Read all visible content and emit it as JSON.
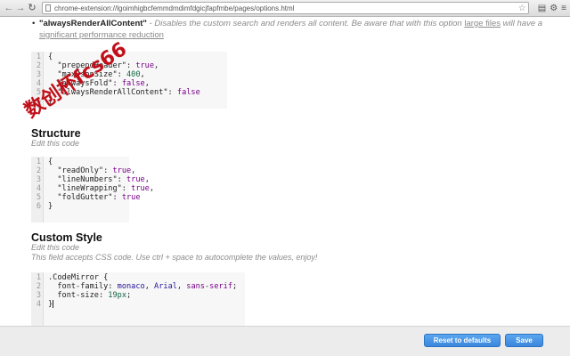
{
  "browser": {
    "url": "chrome-extension://lgoimhigbcfemmdmdimfdgicjfapfmbe/pages/options.html"
  },
  "options": {
    "bullet_title": "\"alwaysRenderAllContent\"",
    "bullet_desc_1": " - Disables the custom search and renders all content. Be aware that with this option ",
    "bullet_link_1": "large files",
    "bullet_desc_2": " will have a ",
    "bullet_link_2": "significant performance reduction"
  },
  "json_code": {
    "lines": [
      {
        "n": "1",
        "t": "{"
      },
      {
        "n": "2",
        "key": "\"prependHeader\"",
        "val": "true",
        "cls": "v"
      },
      {
        "n": "3",
        "key": "\"maxJsonSize\"",
        "val": "400",
        "cls": "n"
      },
      {
        "n": "4",
        "key": "\"alwaysFold\"",
        "val": "false",
        "cls": "v"
      },
      {
        "n": "5",
        "key": "\"alwaysRenderAllContent\"",
        "val": "false",
        "cls": "v",
        "last": true
      },
      {
        "n": "6",
        "t": "}"
      }
    ]
  },
  "structure": {
    "title": "Structure",
    "subtitle": "Edit this code",
    "lines": [
      {
        "n": "1",
        "t": "{"
      },
      {
        "n": "2",
        "key": "\"readOnly\"",
        "val": "true",
        "cls": "v"
      },
      {
        "n": "3",
        "key": "\"lineNumbers\"",
        "val": "true",
        "cls": "v"
      },
      {
        "n": "4",
        "key": "\"lineWrapping\"",
        "val": "true",
        "cls": "v"
      },
      {
        "n": "5",
        "key": "\"foldGutter\"",
        "val": "true",
        "cls": "v",
        "last": true
      },
      {
        "n": "6",
        "t": "}"
      }
    ]
  },
  "custom_style": {
    "title": "Custom Style",
    "subtitle": "Edit this code",
    "hint": "This field accepts CSS code. Use ctrl + space to autocomplete the values, enjoy!",
    "lines": [
      {
        "n": "1",
        "html": ".CodeMirror {"
      },
      {
        "n": "2",
        "html": "  font-family: monaco, Arial, sans-serif;"
      },
      {
        "n": "3",
        "html": "  font-size: 19px;"
      },
      {
        "n": "4",
        "html": "}"
      }
    ]
  },
  "watermark": "数创杯fcs66",
  "footer": {
    "reset_label": "Reset to defaults",
    "save_label": "Save"
  },
  "colors": {
    "button": "#3b86dc",
    "watermark": "#c0101a"
  }
}
